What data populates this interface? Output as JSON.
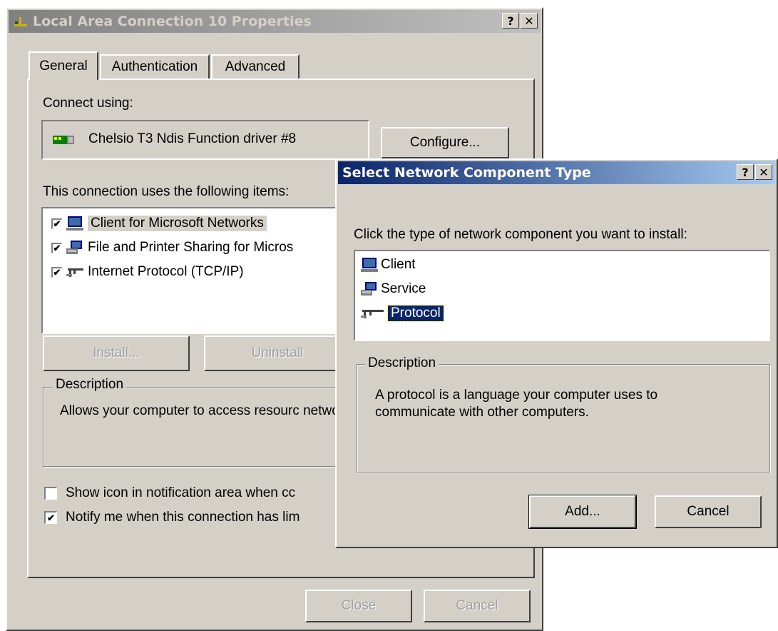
{
  "back_dialog": {
    "title": "Local Area Connection 10 Properties",
    "help_btn": "?",
    "close_btn": "✕",
    "tabs": [
      "General",
      "Authentication",
      "Advanced"
    ],
    "connect_using_label": "Connect using:",
    "adapter_name": "Chelsio T3 Ndis Function driver #8",
    "configure_btn": "Configure...",
    "items_label": "This connection uses the following items:",
    "items": [
      {
        "label": "Client for Microsoft Networks",
        "checked": true
      },
      {
        "label": "File and Printer Sharing for Micros",
        "checked": true
      },
      {
        "label": "Internet Protocol (TCP/IP)",
        "checked": true
      }
    ],
    "install_btn": "Install...",
    "uninstall_btn": "Uninstall",
    "description_legend": "Description",
    "description_text": "Allows your computer to access resourc network.",
    "show_icon_label": "Show icon in notification area when cc",
    "show_icon_checked": false,
    "notify_label": "Notify me when this connection has lim",
    "notify_checked": true,
    "close_btn_label": "Close",
    "cancel_btn_label": "Cancel"
  },
  "front_dialog": {
    "title": "Select Network Component Type",
    "help_btn": "?",
    "close_btn": "✕",
    "instruction": "Click the type of network component you want to install:",
    "components": [
      {
        "label": "Client",
        "icon": "client-icon",
        "selected": false
      },
      {
        "label": "Service",
        "icon": "service-icon",
        "selected": false
      },
      {
        "label": "Protocol",
        "icon": "protocol-icon",
        "selected": true
      }
    ],
    "description_legend": "Description",
    "description_text": "A protocol is a language your computer uses to communicate with other computers.",
    "add_btn": "Add...",
    "cancel_btn": "Cancel"
  },
  "colors": {
    "active_title": "#0a246a",
    "face": "#d4d0c8",
    "selection": "#0a246a"
  }
}
